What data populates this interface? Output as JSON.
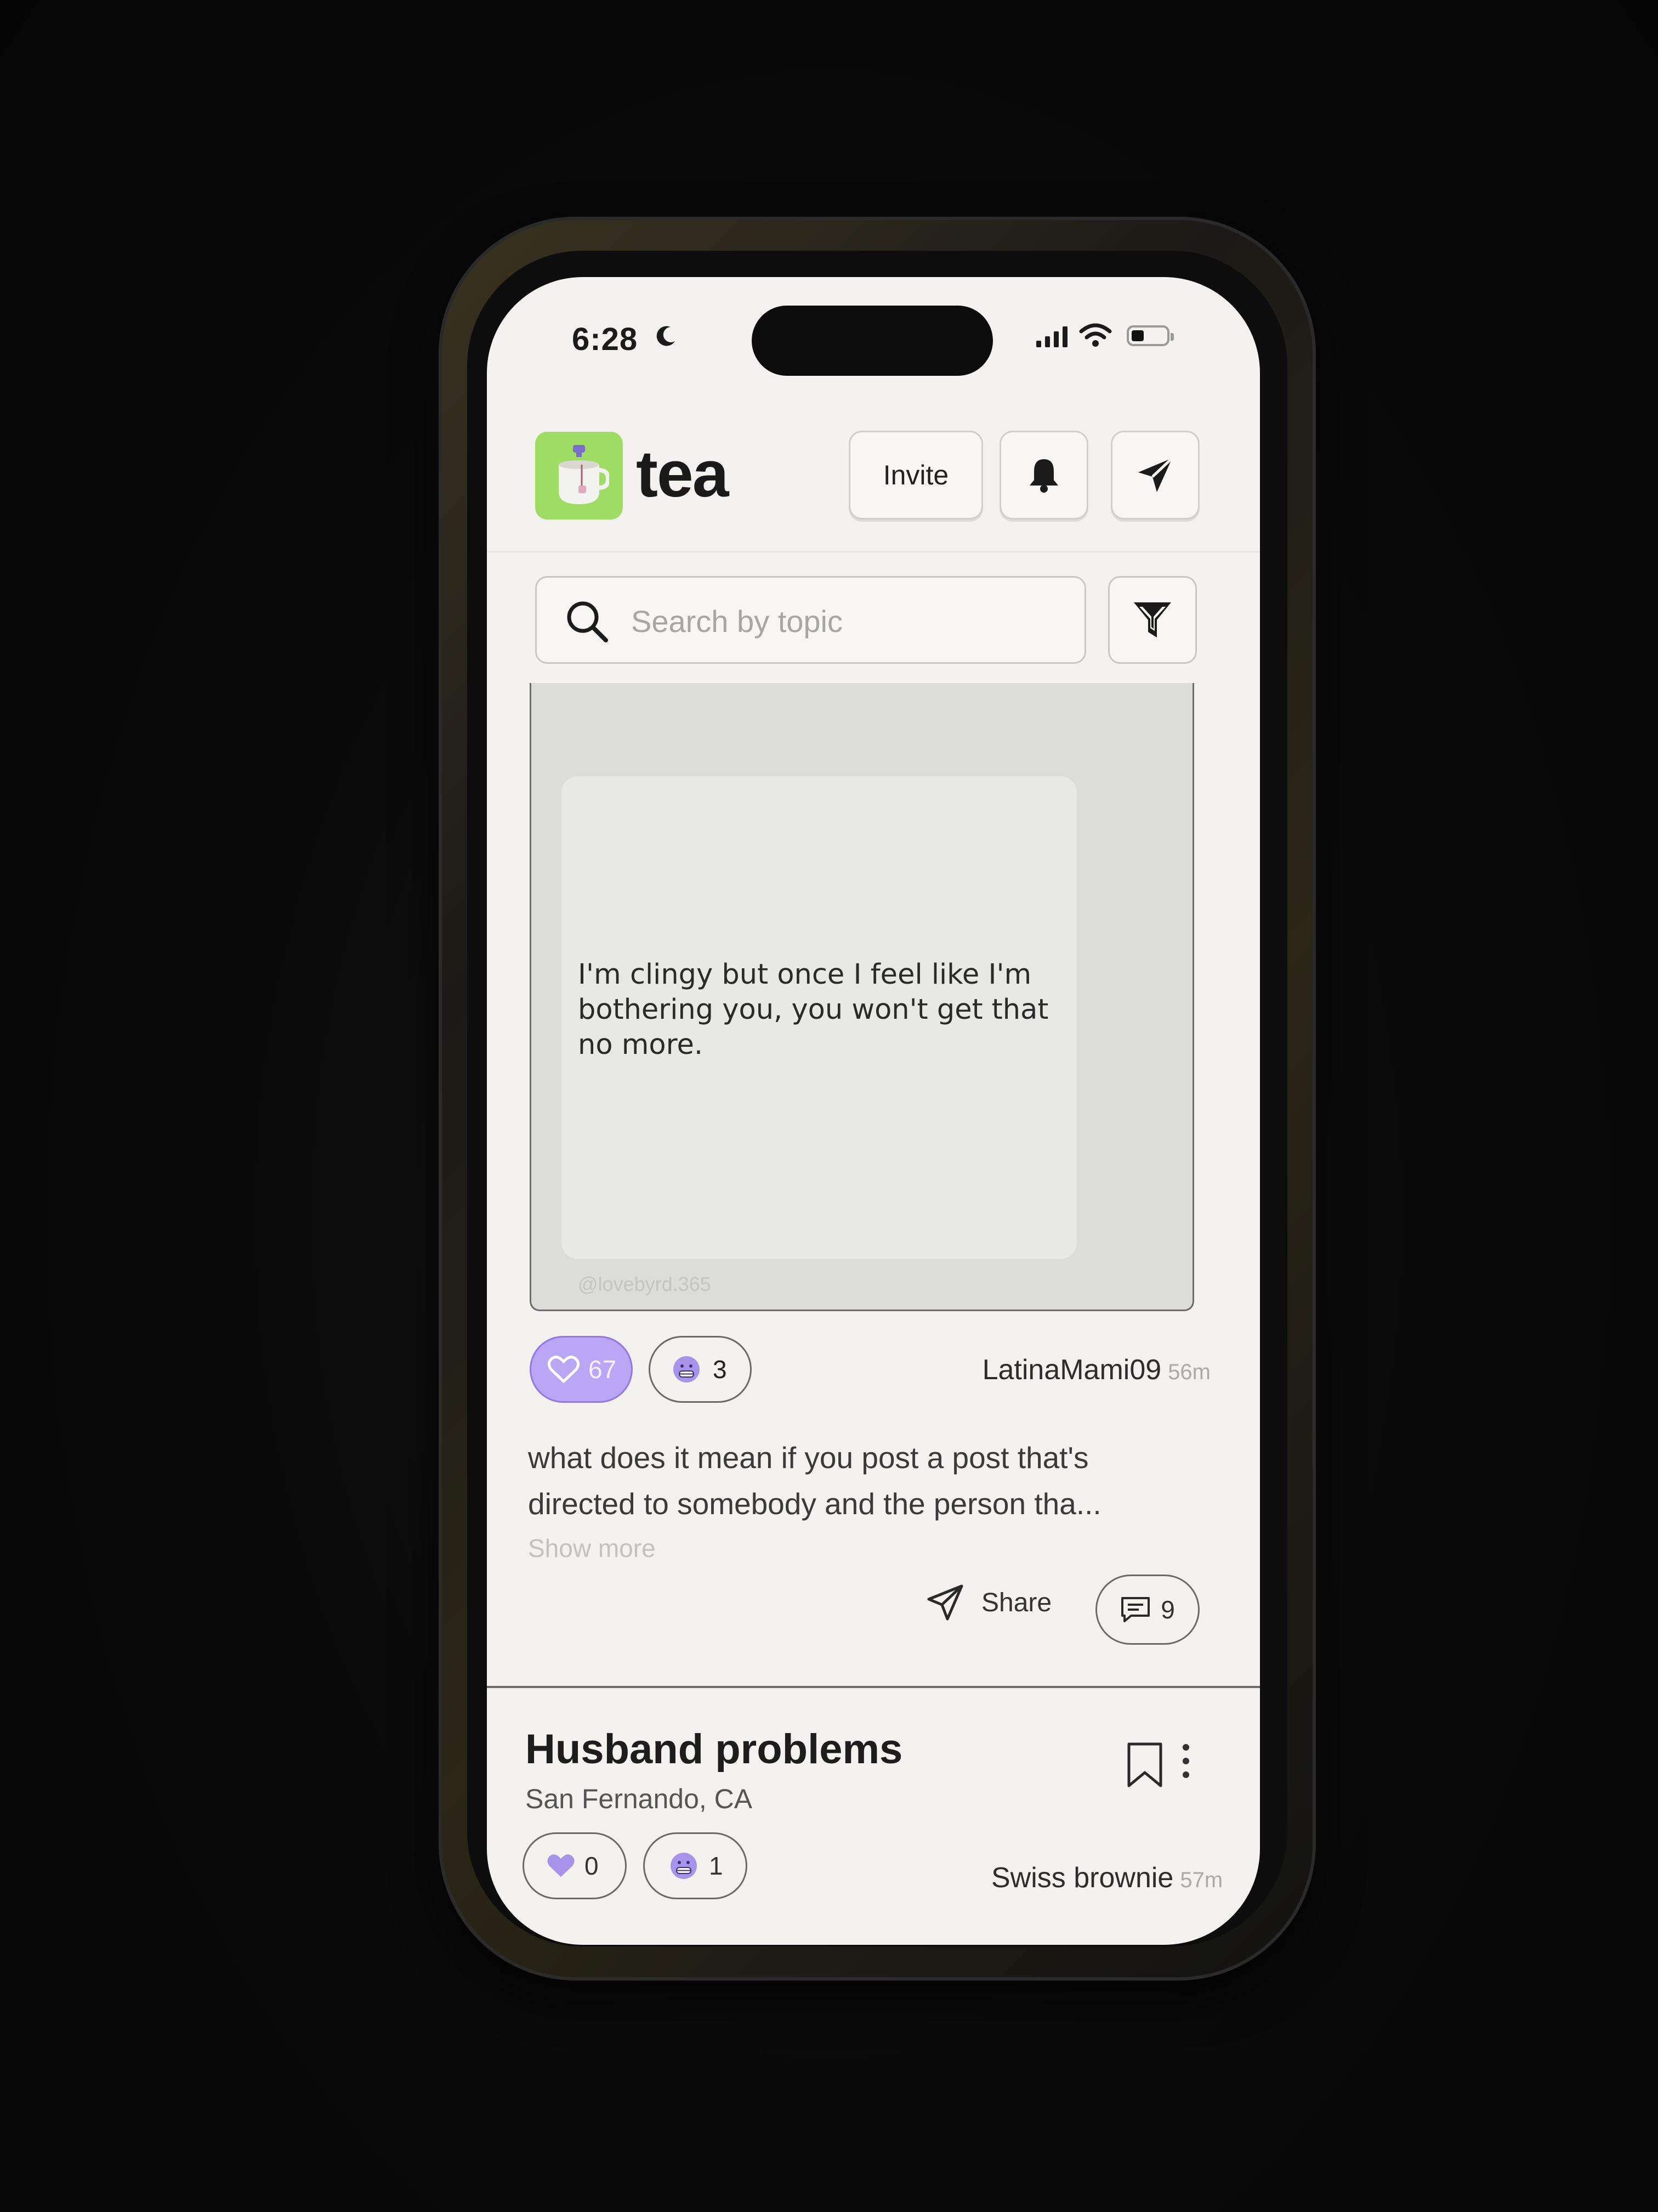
{
  "status_bar": {
    "time": "6:28"
  },
  "header": {
    "app_name": "tea",
    "invite_label": "Invite"
  },
  "search": {
    "placeholder": "Search by topic"
  },
  "post1": {
    "image_text": "I'm clingy but once I feel like I'm bothering you, you won't get that no more.",
    "watermark": "@lovebyrd.365",
    "likes": "67",
    "reactions": "3",
    "author": "LatinaMami09",
    "ago": "56m",
    "body": "what does it mean if you post a post that's directed to somebody and the person tha...",
    "show_more": "Show more",
    "share_label": "Share",
    "comments": "9"
  },
  "post2": {
    "title": "Husband problems",
    "location": "San Fernando, CA",
    "likes": "0",
    "reactions": "1",
    "author": "Swiss brownie",
    "ago": "57m"
  },
  "colors": {
    "brand_green": "#9fdc63",
    "like_purple": "#b9a6f4"
  }
}
